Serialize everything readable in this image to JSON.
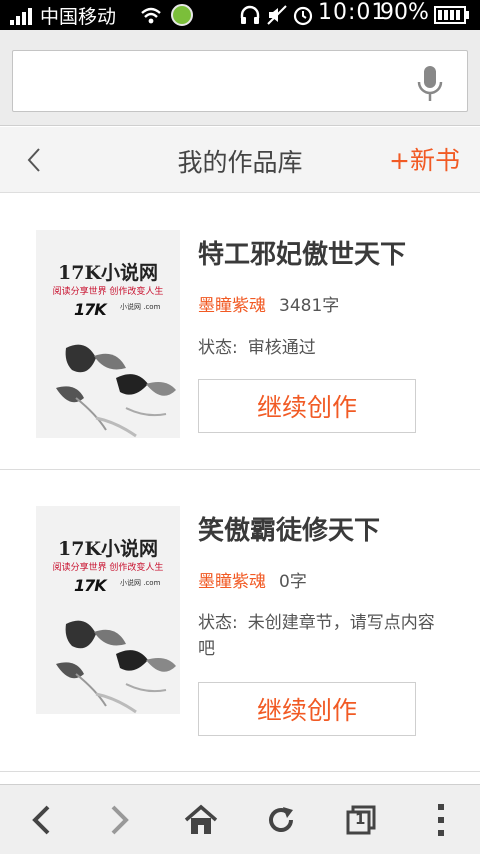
{
  "status_bar": {
    "carrier": "中国移动",
    "time": "10:01",
    "battery": "90%",
    "icons": [
      "signal-icon",
      "wifi-icon",
      "app-icon",
      "headset-icon",
      "mute-icon",
      "alarm-icon",
      "battery-icon"
    ]
  },
  "browser": {
    "url_value": "",
    "mic_icon": "microphone-icon"
  },
  "header": {
    "title": "我的作品库",
    "back_icon": "chevron-left-icon",
    "new_book": "+新书"
  },
  "books": [
    {
      "title": "特工邪妃傲世天下",
      "author": "墨瞳紫魂",
      "word_count": "3481字",
      "status_label": "状态:",
      "status_value": "审核通过",
      "action": "继续创作",
      "cover": {
        "site": "17K小说网",
        "slogan": "阅读分享世界 创作改变人生",
        "logo": "17K",
        "logo_sub": "小说网 .com"
      }
    },
    {
      "title": "笑傲霸徒修天下",
      "author": "墨瞳紫魂",
      "word_count": "0字",
      "status_label": "状态:",
      "status_value": "未创建章节，请写点内容吧",
      "action": "继续创作",
      "cover": {
        "site": "17K小说网",
        "slogan": "阅读分享世界 创作改变人生",
        "logo": "17K",
        "logo_sub": "小说网 .com"
      }
    }
  ],
  "toolbar": {
    "items": [
      "back-icon",
      "forward-icon",
      "home-icon",
      "refresh-icon",
      "tabs-icon",
      "menu-icon"
    ],
    "tab_count": "1"
  },
  "colors": {
    "accent": "#f15a24",
    "text": "#3a3a3a",
    "status_bar": "#000000"
  }
}
